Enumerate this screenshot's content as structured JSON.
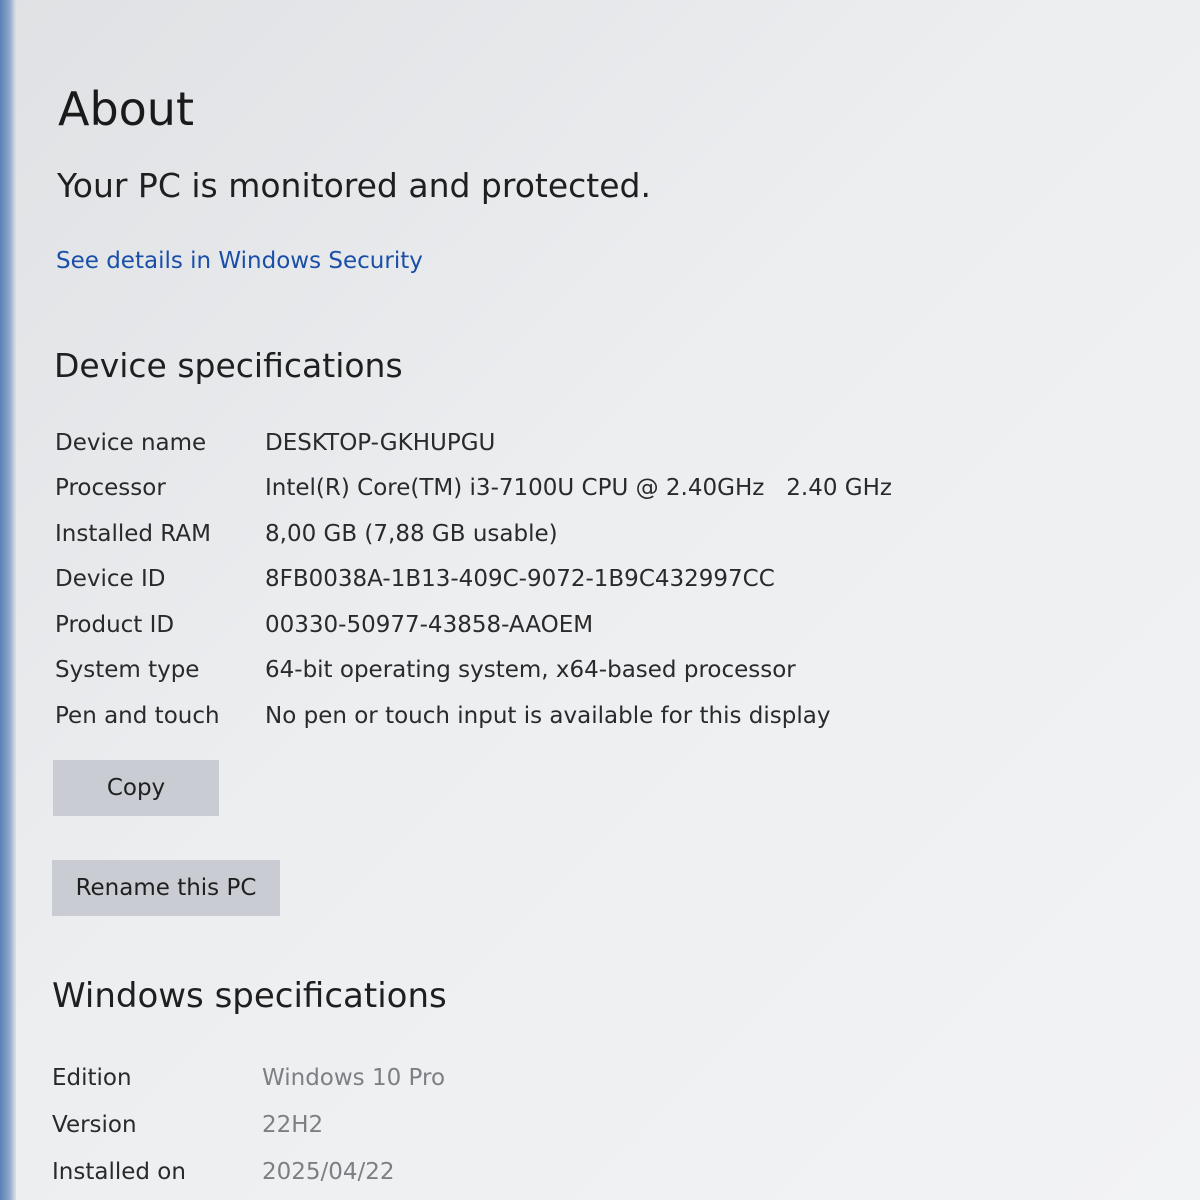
{
  "page": {
    "title": "About",
    "protection_status": "Your PC is monitored and protected.",
    "security_link": "See details in Windows Security"
  },
  "device_specs": {
    "heading": "Device specifications",
    "rows": [
      {
        "label": "Device name",
        "value": "DESKTOP-GKHUPGU"
      },
      {
        "label": "Processor",
        "value": "Intel(R) Core(TM) i3-7100U CPU @ 2.40GHz   2.40 GHz"
      },
      {
        "label": "Installed RAM",
        "value": "8,00 GB (7,88 GB usable)"
      },
      {
        "label": "Device ID",
        "value": "8FB0038A-1B13-409C-9072-1B9C432997CC"
      },
      {
        "label": "Product ID",
        "value": "00330-50977-43858-AAOEM"
      },
      {
        "label": "System type",
        "value": "64-bit operating system, x64-based processor"
      },
      {
        "label": "Pen and touch",
        "value": "No pen or touch input is available for this display"
      }
    ],
    "copy_label": "Copy",
    "rename_label": "Rename this PC"
  },
  "windows_specs": {
    "heading": "Windows specifications",
    "rows": [
      {
        "label": "Edition",
        "value": "Windows 10 Pro"
      },
      {
        "label": "Version",
        "value": "22H2"
      },
      {
        "label": "Installed on",
        "value": "2025/04/22"
      }
    ]
  },
  "colors": {
    "link": "#1a4fa8",
    "button": "#c9ccd3",
    "muted_value": "#7d7f85"
  }
}
